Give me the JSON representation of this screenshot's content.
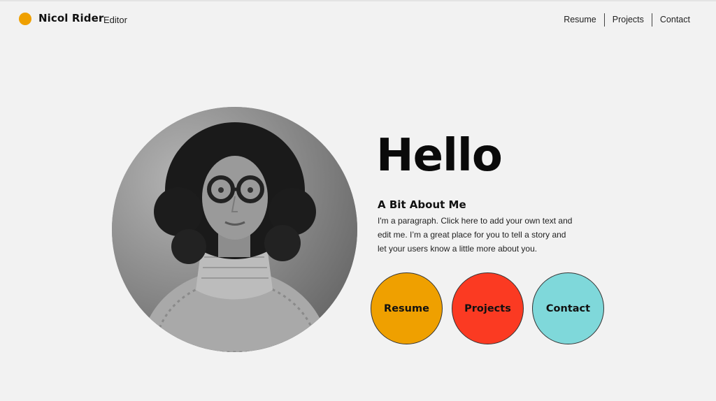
{
  "header": {
    "name": "Nicol Rider",
    "role": "Editor",
    "nav": [
      "Resume",
      "Projects",
      "Contact"
    ]
  },
  "hero": {
    "greeting": "Hello",
    "about_title": "A Bit About Me",
    "about_text": "I'm a paragraph. Click here to add your own text and edit me. I’m a great place for you to tell a story and let your users know a little more about you.",
    "portrait_icon": "portrait-photo"
  },
  "buttons": [
    {
      "label": "Resume",
      "color": "#efa000"
    },
    {
      "label": "Projects",
      "color": "#fb3a22"
    },
    {
      "label": "Contact",
      "color": "#7fd8da"
    }
  ],
  "colors": {
    "background": "#f2f2f2",
    "brand_dot": "#efa000"
  }
}
